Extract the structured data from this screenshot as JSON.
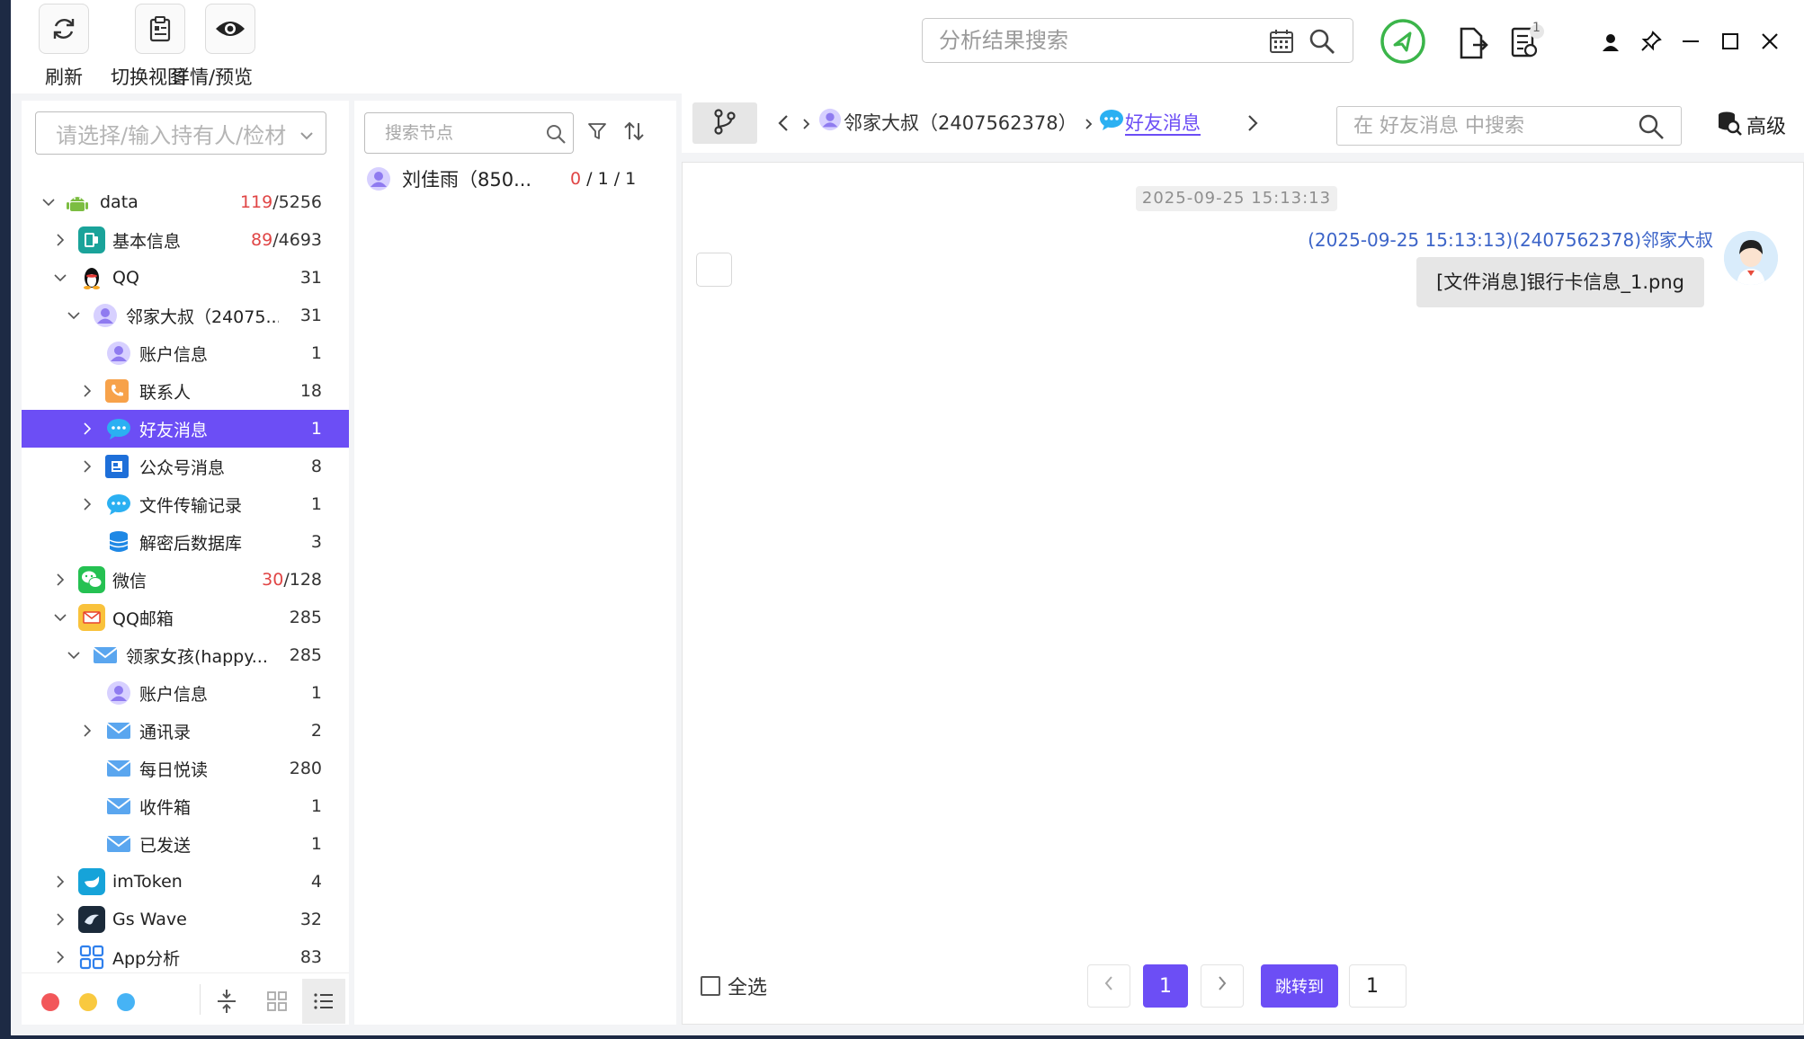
{
  "toolbar": {
    "refresh_label": "刷新",
    "switch_view_label": "切换视图",
    "detail_preview_label": "详情/预览"
  },
  "top_search": {
    "placeholder": "分析结果搜索"
  },
  "notifications": {
    "badge_count": "1"
  },
  "left": {
    "owner_placeholder": "请选择/输入持有人/检材",
    "tree": [
      {
        "label": "data",
        "count_red": "119",
        "count": "/5256"
      },
      {
        "label": "基本信息",
        "count_red": "89",
        "count": "/4693"
      },
      {
        "label": "QQ",
        "count_red": "",
        "count": "31"
      },
      {
        "label": "邻家大叔（24075...",
        "count_red": "",
        "count": "31"
      },
      {
        "label": "账户信息",
        "count_red": "",
        "count": "1"
      },
      {
        "label": "联系人",
        "count_red": "",
        "count": "18"
      },
      {
        "label": "好友消息",
        "count_red": "",
        "count": "1"
      },
      {
        "label": "公众号消息",
        "count_red": "",
        "count": "8"
      },
      {
        "label": "文件传输记录",
        "count_red": "",
        "count": "1"
      },
      {
        "label": "解密后数据库",
        "count_red": "",
        "count": "3"
      },
      {
        "label": "微信",
        "count_red": "30",
        "count": "/128"
      },
      {
        "label": "QQ邮箱",
        "count_red": "",
        "count": "285"
      },
      {
        "label": "领家女孩(happy...",
        "count_red": "",
        "count": "285"
      },
      {
        "label": "账户信息",
        "count_red": "",
        "count": "1"
      },
      {
        "label": "通讯录",
        "count_red": "",
        "count": "2"
      },
      {
        "label": "每日悦读",
        "count_red": "",
        "count": "280"
      },
      {
        "label": "收件箱",
        "count_red": "",
        "count": "1"
      },
      {
        "label": "已发送",
        "count_red": "",
        "count": "1"
      },
      {
        "label": "imToken",
        "count_red": "",
        "count": "4"
      },
      {
        "label": "Gs Wave",
        "count_red": "",
        "count": "32"
      },
      {
        "label": "App分析",
        "count_red": "",
        "count": "83"
      }
    ]
  },
  "middle": {
    "search_placeholder": "搜索节点",
    "items": [
      {
        "label": "刘佳雨（850...",
        "count_red": "0",
        "count": " / 1 / 1"
      }
    ]
  },
  "right": {
    "crumb_account": "邻家大叔（2407562378）",
    "crumb_current": "好友消息",
    "search_placeholder": "在 好友消息 中搜索",
    "advanced_label": "高级"
  },
  "chat": {
    "date": "2025-09-25 15:13:13",
    "sender": "(2025-09-25 15:13:13)(2407562378)邻家大叔",
    "message": "[文件消息]银行卡信息_1.png"
  },
  "footer": {
    "select_all": "全选",
    "current_page": "1",
    "jump_label": "跳转到",
    "jump_value": "1"
  },
  "colors": {
    "accent": "#6c4ef5",
    "selected_row": "#6c4ef5",
    "red_count": "#e04545",
    "sender_blue": "#3c64c8",
    "status_green": "#3bb54a"
  }
}
